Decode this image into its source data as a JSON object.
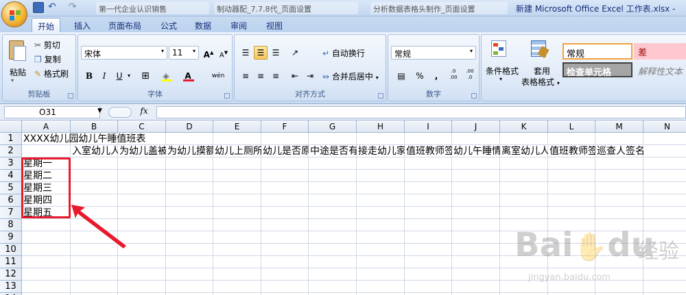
{
  "window": {
    "title": "新建 Microsoft Office Excel 工作表.xlsx -"
  },
  "doc_tabs": [
    "第一代企业认识销售",
    "制动器配_7.7.8代_页面设置",
    "分析数据表格头制作_页面设置"
  ],
  "tabs": [
    "开始",
    "插入",
    "页面布局",
    "公式",
    "数据",
    "审阅",
    "视图"
  ],
  "ribbon": {
    "clipboard": {
      "paste": "粘贴",
      "cut": "剪切",
      "copy": "复制",
      "format_painter": "格式刷",
      "label": "剪贴板"
    },
    "font": {
      "name": "宋体",
      "size": "11",
      "bold": "B",
      "italic": "I",
      "underline": "U",
      "grow": "A",
      "shrink": "A",
      "font_color": "A",
      "wen": "wén",
      "label": "字体"
    },
    "alignment": {
      "wrap": "自动换行",
      "merge": "合并后居中",
      "label": "对齐方式"
    },
    "number": {
      "format": "常规",
      "percent": "%",
      "comma": ",",
      "inc": ".0 .00",
      "dec": ".00 .0",
      "label": "数字"
    },
    "styles": {
      "conditional": "条件格式",
      "table": "套用",
      "table2": "表格格式",
      "normal": "常规",
      "bad": "差",
      "check_cell": "检查单元格",
      "explanatory": "解释性文本"
    }
  },
  "formula_bar": {
    "name_box": "O31",
    "fx": "fx",
    "value": ""
  },
  "columns": [
    "A",
    "B",
    "C",
    "D",
    "E",
    "F",
    "G",
    "H",
    "I",
    "J",
    "K",
    "L",
    "M",
    "N"
  ],
  "rows": [
    "1",
    "2",
    "3",
    "4",
    "5",
    "6",
    "7",
    "8",
    "9",
    "10",
    "11",
    "12",
    "13",
    "14"
  ],
  "cells": {
    "A1": "XXXX幼儿园幼儿午睡值班表",
    "B2": "入室幼儿人数",
    "C2": "为幼儿盖被",
    "D2": "为幼儿摸额",
    "E2": "幼儿上厕所",
    "F2": "幼儿是否原",
    "G2": "中途是否有",
    "H2": "接走幼儿家",
    "I2": "值班教师签",
    "J2": "幼儿午睡情",
    "K2": "离室幼儿人",
    "L2": "值班教师签",
    "M2": "巡查人签名",
    "A3": "星期一",
    "A4": "星期二",
    "A5": "星期三",
    "A6": "星期四",
    "A7": "星期五"
  },
  "watermark": {
    "brand": "Bai",
    "brand2": "du",
    "cn": "经验",
    "url": "jingyan.baidu.com"
  },
  "colors": {
    "highlight": "#e8192c",
    "accent": "#15307a"
  }
}
